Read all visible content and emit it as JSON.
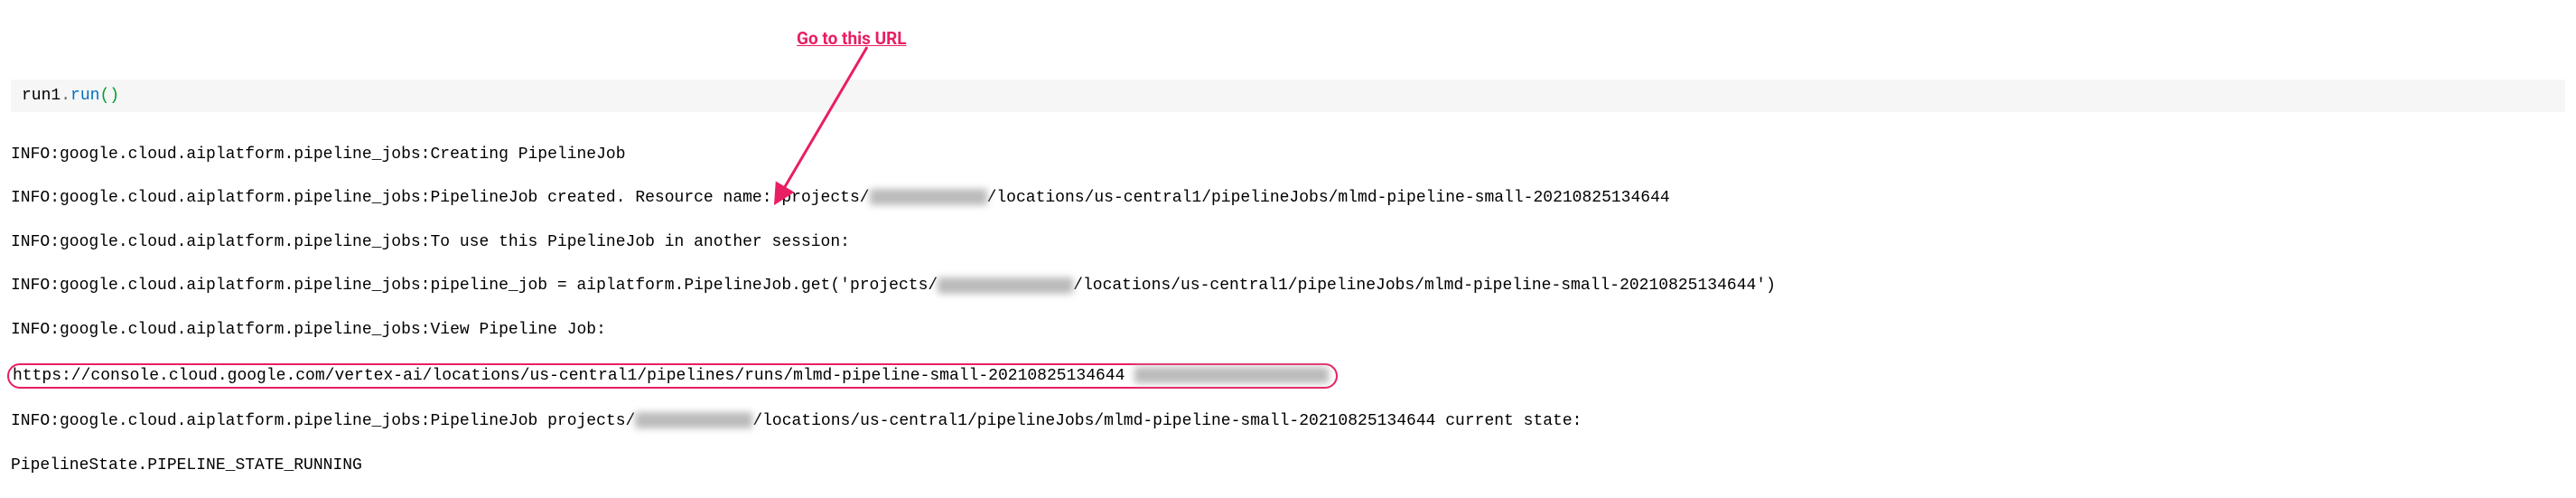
{
  "annotation": {
    "label": "Go to this URL"
  },
  "code": {
    "obj": "run1",
    "dot": ".",
    "method": "run",
    "paren_open": "(",
    "paren_close": ")"
  },
  "output": {
    "l1": "INFO:google.cloud.aiplatform.pipeline_jobs:Creating PipelineJob",
    "l2a": "INFO:google.cloud.aiplatform.pipeline_jobs:PipelineJob created. Resource name: projects/",
    "l2b": "/locations/us-central1/pipelineJobs/mlmd-pipeline-small-20210825134644",
    "l3": "INFO:google.cloud.aiplatform.pipeline_jobs:To use this PipelineJob in another session:",
    "l4a": "INFO:google.cloud.aiplatform.pipeline_jobs:pipeline_job = aiplatform.PipelineJob.get('projects/",
    "l4b": "/locations/us-central1/pipelineJobs/mlmd-pipeline-small-20210825134644')",
    "l5": "INFO:google.cloud.aiplatform.pipeline_jobs:View Pipeline Job:",
    "l6": "https://console.cloud.google.com/vertex-ai/locations/us-central1/pipelines/runs/mlmd-pipeline-small-20210825134644",
    "l7a": "INFO:google.cloud.aiplatform.pipeline_jobs:PipelineJob projects/",
    "l7b": "/locations/us-central1/pipelineJobs/mlmd-pipeline-small-20210825134644 current state:",
    "l8": "PipelineState.PIPELINE_STATE_RUNNING"
  }
}
